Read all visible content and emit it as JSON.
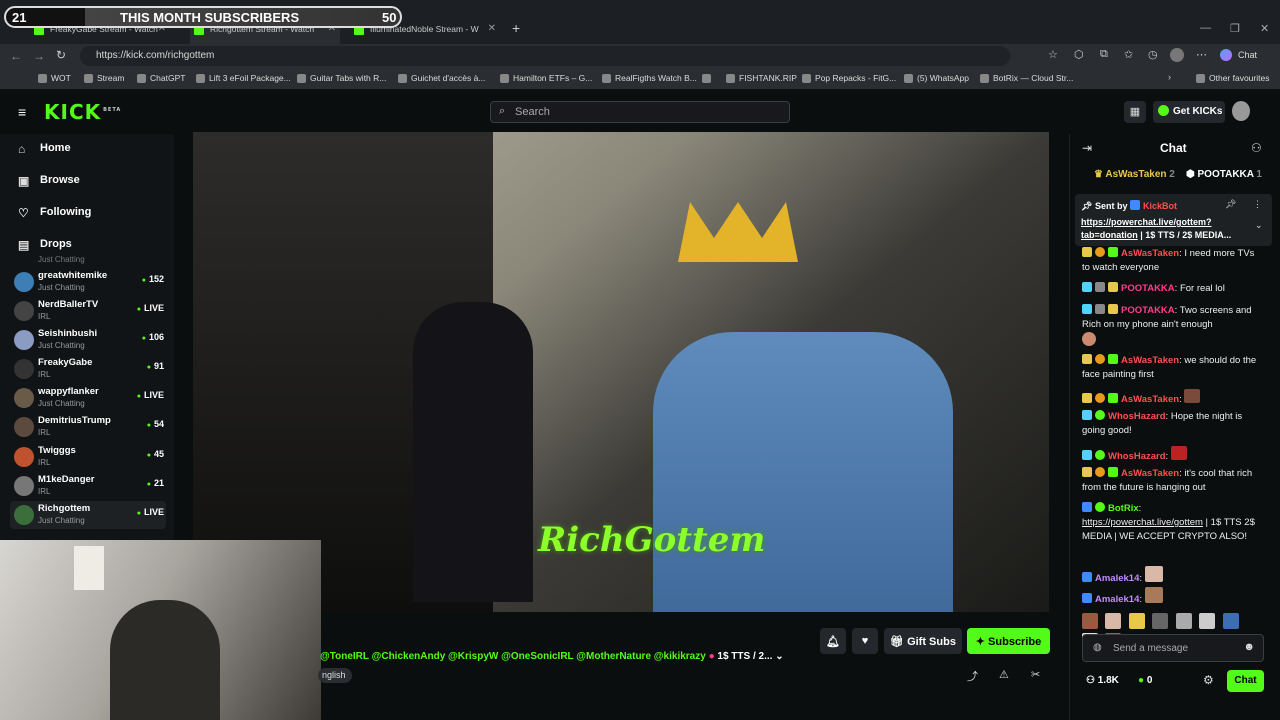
{
  "subscriber_goal": {
    "current": "21",
    "title": "THIS MONTH SUBSCRIBERS",
    "target": "50"
  },
  "browser": {
    "tabs": [
      {
        "label": "FreakyGabe Stream - Watch"
      },
      {
        "label": "Richgottem Stream - Watch"
      },
      {
        "label": "IlluminatedNoble Stream - W"
      }
    ],
    "new_tab": "+",
    "url": "https://kick.com/richgottem",
    "copilot_label": "Chat",
    "bookmarks": [
      "WOT",
      "Stream",
      "ChatGPT",
      "Lift 3 eFoil Package...",
      "Guitar Tabs with R...",
      "Guichet d'accès à...",
      "Hamilton ETFs – G...",
      "RealFigths Watch B...",
      "",
      "FISHTANK.RIP",
      "Pop Repacks - FitG...",
      "(5) WhatsApp",
      "BotRix — Cloud Str..."
    ],
    "other_favourites": "Other favourites"
  },
  "kick": {
    "logo": "KICK",
    "logo_beta": "BETA",
    "search_placeholder": "Search",
    "get_kicks": "Get KICKs",
    "nav": [
      {
        "label": "Home",
        "icon": "home-icon"
      },
      {
        "label": "Browse",
        "icon": "browse-icon"
      },
      {
        "label": "Following",
        "icon": "heart-icon"
      },
      {
        "label": "Drops",
        "icon": "drops-icon"
      }
    ],
    "partial_category": "Just Chatting",
    "channels": [
      {
        "name": "greatwhitemike",
        "category": "Just Chatting",
        "viewers": "152"
      },
      {
        "name": "NerdBallerTV",
        "category": "IRL",
        "viewers": "LIVE"
      },
      {
        "name": "Seishinbushi",
        "category": "Just Chatting",
        "viewers": "106"
      },
      {
        "name": "FreakyGabe",
        "category": "IRL",
        "viewers": "91"
      },
      {
        "name": "wappyflanker",
        "category": "Just Chatting",
        "viewers": "LIVE"
      },
      {
        "name": "DemitriusTrump",
        "category": "IRL",
        "viewers": "54"
      },
      {
        "name": "Twigggs",
        "category": "IRL",
        "viewers": "45"
      },
      {
        "name": "M1keDanger",
        "category": "IRL",
        "viewers": "21"
      },
      {
        "name": "Richgottem",
        "category": "Just Chatting",
        "viewers": "LIVE"
      }
    ],
    "video_overlay_text": "RichGottem",
    "stream_tags": "@ToneIRL @ChickenAndy @KrispyW @OneSonicIRL @MotherNature @kikikrazy",
    "stream_tags_suffix": "1$ TTS / 2...",
    "language": "nglish",
    "gift_subs": "Gift Subs",
    "subscribe": "Subscribe"
  },
  "chat": {
    "title": "Chat",
    "top_gifters": [
      {
        "name": "AsWasTaken",
        "count": "2"
      },
      {
        "name": "POOTAKKA",
        "count": "1"
      }
    ],
    "pinned": {
      "sent_by": "Sent by",
      "sender": "KickBot",
      "link": "https://powerchat.live/gottem?tab=donation",
      "text": " | 1$ TTS / 2$ MEDIA..."
    },
    "messages": [
      {
        "user": "AsWasTaken",
        "color": "red",
        "text": "I need more TVs to watch everyone"
      },
      {
        "user": "POOTAKKA",
        "color": "pink",
        "text": "For real lol"
      },
      {
        "user": "POOTAKKA",
        "color": "pink",
        "text": "Two screens and Rich on my phone ain't enough"
      },
      {
        "user": "AsWasTaken",
        "color": "red",
        "text": "we should do the face painting first"
      },
      {
        "user": "AsWasTaken",
        "color": "red",
        "text": ""
      },
      {
        "user": "WhosHazard",
        "color": "red",
        "text": "Hope the night is going good!"
      },
      {
        "user": "WhosHazard",
        "color": "red",
        "text": ""
      },
      {
        "user": "AsWasTaken",
        "color": "red",
        "text": "it's cool that rich from the future is hanging out"
      },
      {
        "user": "BotRix",
        "color": "green",
        "link": "https://powerchat.live/gottem",
        "text": " | 1$ TTS 2$ MEDIA | WE ACCEPT CRYPTO ALSO!"
      },
      {
        "user": "Amalek14",
        "color": "purple",
        "text": ""
      },
      {
        "user": "Amalek14",
        "color": "purple",
        "text": ""
      }
    ],
    "input_placeholder": "Send a message",
    "followers": "1.8K",
    "kicks": "0",
    "send_label": "Chat"
  },
  "colors": {
    "kick_green": "#53fc18",
    "background": "#0b0e0f",
    "panel": "#1e2124"
  }
}
